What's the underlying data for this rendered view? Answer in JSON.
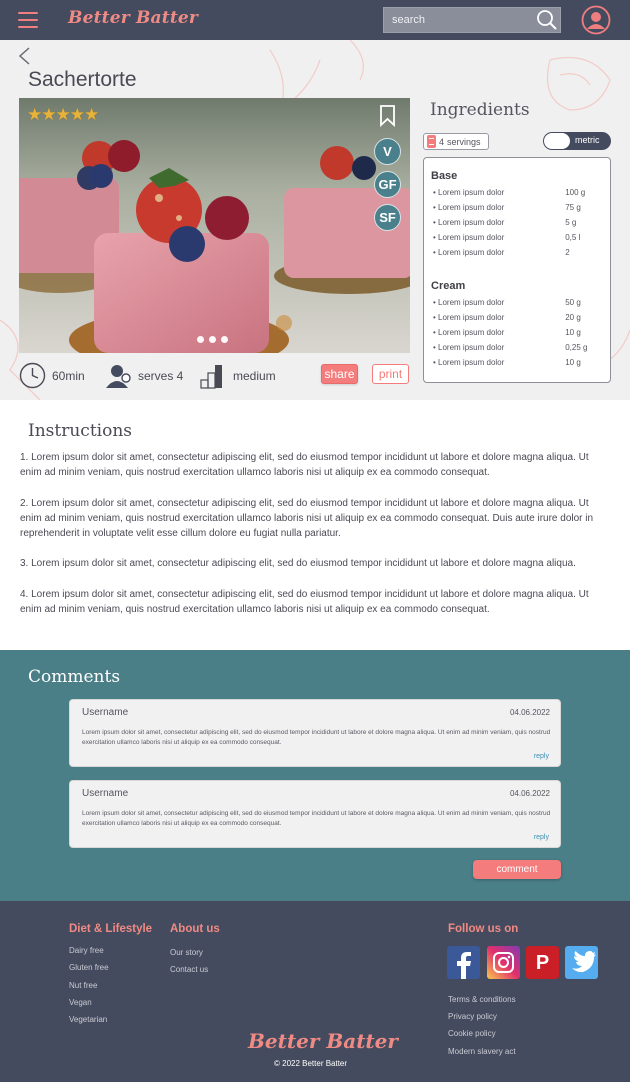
{
  "header": {
    "logo": "Better Batter",
    "search_placeholder": "search"
  },
  "recipe": {
    "title": "Sachertorte",
    "rating_stars": "★★★★★",
    "diet_badges": [
      "V",
      "GF",
      "SF"
    ],
    "time": "60min",
    "serves": "serves 4",
    "difficulty": "medium",
    "share_label": "share",
    "print_label": "print"
  },
  "ingredients": {
    "title": "Ingredients",
    "servings_count": "4",
    "servings_label": "servings",
    "units_label": "metric",
    "groups": [
      {
        "name": "Base",
        "items": [
          {
            "name": "Lorem ipsum dolor",
            "amount": "100 g"
          },
          {
            "name": "Lorem ipsum dolor",
            "amount": "75 g"
          },
          {
            "name": "Lorem ipsum dolor",
            "amount": "5 g"
          },
          {
            "name": "Lorem ipsum dolor",
            "amount": "0,5 l"
          },
          {
            "name": "Lorem ipsum dolor",
            "amount": "2"
          }
        ]
      },
      {
        "name": "Cream",
        "items": [
          {
            "name": "Lorem ipsum dolor",
            "amount": "50 g"
          },
          {
            "name": "Lorem ipsum dolor",
            "amount": "20 g"
          },
          {
            "name": "Lorem ipsum dolor",
            "amount": "10 g"
          },
          {
            "name": "Lorem ipsum dolor",
            "amount": "0,25 g"
          },
          {
            "name": "Lorem ipsum dolor",
            "amount": "10 g"
          }
        ]
      }
    ]
  },
  "instructions": {
    "title": "Instructions",
    "steps": [
      "1. Lorem ipsum dolor sit amet, consectetur adipiscing elit, sed do eiusmod tempor incididunt ut labore et dolore magna aliqua. Ut enim ad minim veniam, quis nostrud exercitation ullamco laboris nisi ut aliquip ex ea commodo consequat.",
      "2. Lorem ipsum dolor sit amet, consectetur adipiscing elit, sed do eiusmod tempor incididunt ut labore et dolore magna aliqua. Ut enim ad minim veniam, quis nostrud exercitation ullamco laboris nisi ut aliquip ex ea commodo consequat. Duis aute irure dolor in reprehenderit in voluptate velit esse cillum dolore eu fugiat nulla pariatur.",
      "3. Lorem ipsum dolor sit amet, consectetur adipiscing elit, sed do eiusmod tempor incididunt ut labore et dolore magna aliqua.",
      "4. Lorem ipsum dolor sit amet, consectetur adipiscing elit, sed do eiusmod tempor incididunt ut labore et dolore magna aliqua. Ut enim ad minim veniam, quis nostrud exercitation ullamco laboris nisi ut aliquip ex ea commodo consequat."
    ]
  },
  "comments": {
    "title": "Comments",
    "items": [
      {
        "user": "Username",
        "date": "04.06.2022",
        "text": "Lorem ipsum dolor sit amet, consectetur adipiscing elit, sed do eiusmod tempor incididunt ut labore et dolore magna aliqua. Ut enim ad minim veniam, quis nostrud exercitation ullamco laboris nisi ut aliquip ex ea commodo consequat.",
        "reply": "reply"
      },
      {
        "user": "Username",
        "date": "04.06.2022",
        "text": "Lorem ipsum dolor sit amet, consectetur adipiscing elit, sed do eiusmod tempor incididunt ut labore et dolore magna aliqua. Ut enim ad minim veniam, quis nostrud exercitation ullamco laboris nisi ut aliquip ex ea commodo consequat.",
        "reply": "reply"
      }
    ],
    "comment_button": "comment"
  },
  "footer": {
    "diet_heading": "Diet & Lifestyle",
    "diet_links": [
      "Dairy free",
      "Gluten free",
      "Nut free",
      "Vegan",
      "Vegetarian"
    ],
    "about_heading": "About us",
    "about_links": [
      "Our story",
      "Contact us"
    ],
    "follow_heading": "Follow us on",
    "social": [
      "facebook-icon",
      "instagram-icon",
      "pinterest-icon",
      "twitter-icon"
    ],
    "legal_links": [
      "Terms & conditions",
      "Privacy policy",
      "Cookie policy",
      "Modern slavery act"
    ],
    "logo": "Better Batter",
    "copyright": "© 2022 Better Batter"
  },
  "colors": {
    "header_bg": "#454b5e",
    "accent_coral": "#f47c7c",
    "teal": "#4a7f88",
    "section_gray": "#f0f0f0"
  }
}
